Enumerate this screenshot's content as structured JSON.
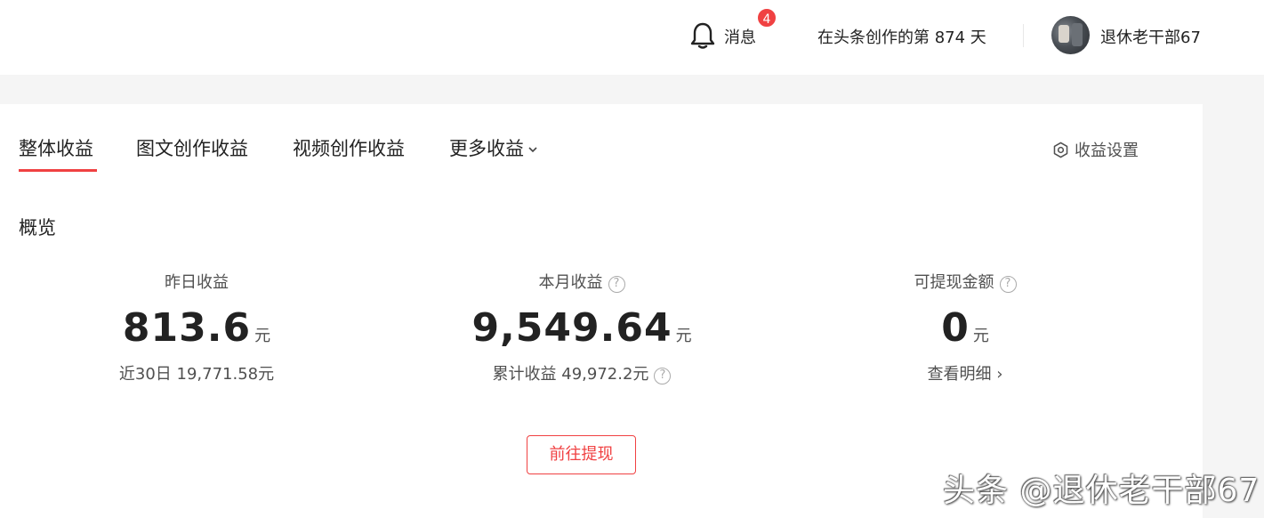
{
  "header": {
    "messages_label": "消息",
    "messages_badge": "4",
    "days_text": "在头条创作的第 874 天",
    "username": "退休老干部67"
  },
  "tabs": [
    {
      "label": "整体收益",
      "active": true
    },
    {
      "label": "图文创作收益",
      "active": false
    },
    {
      "label": "视频创作收益",
      "active": false
    },
    {
      "label": "更多收益",
      "active": false
    }
  ],
  "settings_label": "收益设置",
  "overview_title": "概览",
  "stats": [
    {
      "label": "昨日收益",
      "value": "813.6",
      "unit": "元",
      "sub": "近30日 19,771.58元"
    },
    {
      "label": "本月收益",
      "value": "9,549.64",
      "unit": "元",
      "sub": "累计收益 49,972.2元"
    },
    {
      "label": "可提现金额",
      "value": "0",
      "unit": "元",
      "sub": "查看明细 ›"
    }
  ],
  "withdraw_button": "前往提现",
  "help_icon_glyph": "?",
  "watermark": "头条 @退休老干部67",
  "colors": {
    "accent": "#f04142",
    "text": "#222222",
    "muted": "#505050"
  }
}
